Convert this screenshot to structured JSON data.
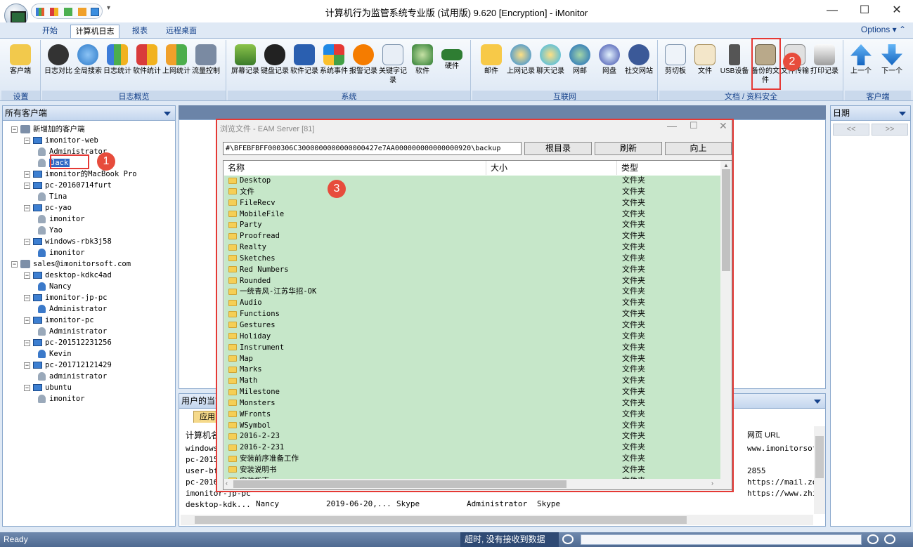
{
  "window": {
    "title": "计算机行为监管系统专业版 (试用版) 9.620 [Encryption] - iMonitor",
    "minimize": "—",
    "maximize": "☐",
    "close": "✕"
  },
  "tabs": [
    {
      "label": "开始"
    },
    {
      "label": "计算机日志",
      "active": true
    },
    {
      "label": "报表"
    },
    {
      "label": "远程桌面"
    }
  ],
  "options_label": "Options",
  "ribbon_groups": [
    {
      "label": "设置",
      "buttons": [
        {
          "label": "客户端"
        }
      ]
    },
    {
      "label": "日志概览",
      "buttons": [
        {
          "label": "日志对比"
        },
        {
          "label": "全局搜索"
        },
        {
          "label": "日志统计"
        },
        {
          "label": "软件统计"
        },
        {
          "label": "上网统计"
        },
        {
          "label": "流量控制"
        }
      ]
    },
    {
      "label": "系统",
      "buttons": [
        {
          "label": "屏幕记录"
        },
        {
          "label": "键盘记录"
        },
        {
          "label": "软件记录"
        },
        {
          "label": "系统事件"
        },
        {
          "label": "报警记录"
        },
        {
          "label": "关键字记录"
        },
        {
          "label": "软件"
        },
        {
          "label": "硬件"
        }
      ]
    },
    {
      "label": "互联网",
      "buttons": [
        {
          "label": "邮件"
        },
        {
          "label": "上网记录"
        },
        {
          "label": "聊天记录"
        },
        {
          "label": "网邮"
        },
        {
          "label": "网盘"
        },
        {
          "label": "社交网站"
        }
      ]
    },
    {
      "label": "文档 / 资料安全",
      "buttons": [
        {
          "label": "剪切板"
        },
        {
          "label": "文件"
        },
        {
          "label": "USB设备"
        },
        {
          "label": "备份的文件"
        },
        {
          "label": "文件传输"
        },
        {
          "label": "打印记录"
        }
      ]
    },
    {
      "label": "客户端",
      "buttons": [
        {
          "label": "上一个"
        },
        {
          "label": "下一个"
        }
      ]
    }
  ],
  "left_panel": {
    "title": "所有客户端"
  },
  "tree": [
    {
      "label": "新增加的客户端",
      "level": 0,
      "kind": "group"
    },
    {
      "label": "imonitor-web",
      "level": 1,
      "kind": "pc"
    },
    {
      "label": "Administrator",
      "level": 2,
      "kind": "user"
    },
    {
      "label": "Jack",
      "level": 2,
      "kind": "user",
      "selected": true
    },
    {
      "label": "imonitor的MacBook Pro",
      "level": 1,
      "kind": "pc"
    },
    {
      "label": "pc-20160714furt",
      "level": 1,
      "kind": "pc"
    },
    {
      "label": "Tina",
      "level": 2,
      "kind": "user"
    },
    {
      "label": "pc-yao",
      "level": 1,
      "kind": "pc"
    },
    {
      "label": "imonitor",
      "level": 2,
      "kind": "user"
    },
    {
      "label": "Yao",
      "level": 2,
      "kind": "user"
    },
    {
      "label": "windows-rbk3j58",
      "level": 1,
      "kind": "pc"
    },
    {
      "label": "imonitor",
      "level": 2,
      "kind": "user-blue"
    },
    {
      "label": "sales@imonitorsoft.com",
      "level": 0,
      "kind": "group"
    },
    {
      "label": "desktop-kdkc4ad",
      "level": 1,
      "kind": "pc"
    },
    {
      "label": "Nancy",
      "level": 2,
      "kind": "user-blue"
    },
    {
      "label": "imonitor-jp-pc",
      "level": 1,
      "kind": "pc"
    },
    {
      "label": "Administrator",
      "level": 2,
      "kind": "user-blue"
    },
    {
      "label": "imonitor-pc",
      "level": 1,
      "kind": "pc"
    },
    {
      "label": "Administrator",
      "level": 2,
      "kind": "user"
    },
    {
      "label": "pc-201512231256",
      "level": 1,
      "kind": "pc"
    },
    {
      "label": "Kevin",
      "level": 2,
      "kind": "user-blue"
    },
    {
      "label": "pc-201712121429",
      "level": 1,
      "kind": "pc"
    },
    {
      "label": "administrator",
      "level": 2,
      "kind": "user"
    },
    {
      "label": "ubuntu",
      "level": 1,
      "kind": "pc"
    },
    {
      "label": "imonitor",
      "level": 2,
      "kind": "user"
    }
  ],
  "right_panel": {
    "title": "日期",
    "prev": "<<",
    "next": ">>"
  },
  "bottom_panel": {
    "title": "用户的当前",
    "tab": "应用",
    "header_left": "计算机名",
    "header_right": "网页 URL",
    "rows_left": [
      "windows",
      "pc-2015",
      "user-bf",
      "pc-2016",
      "imonitor-jp-pc",
      "desktop-kdk..."
    ],
    "row_user": "Nancy",
    "row_date": "2019-06-20,...",
    "row_app": "Skype",
    "row_admin": "Administrator",
    "row_app2": "Skype",
    "urls": [
      "www.imonitorsof",
      "",
      "2855",
      "https://mail.zo",
      "https://www.zhi"
    ]
  },
  "dialog": {
    "title": "浏览文件 - EAM Server [81]",
    "path": "#\\BFEBFBFF000306C3000000000000000427e7AA000000000000000920\\backup",
    "btn_root": "根目录",
    "btn_refresh": "刷新",
    "btn_up": "向上",
    "col_name": "名称",
    "col_size": "大小",
    "col_type": "类型",
    "rows": [
      {
        "name": "Desktop",
        "type": "文件夹"
      },
      {
        "name": "文件",
        "type": "文件夹"
      },
      {
        "name": "FileRecv",
        "type": "文件夹"
      },
      {
        "name": "MobileFile",
        "type": "文件夹"
      },
      {
        "name": "Party",
        "type": "文件夹"
      },
      {
        "name": "Proofread",
        "type": "文件夹"
      },
      {
        "name": "Realty",
        "type": "文件夹"
      },
      {
        "name": "Sketches",
        "type": "文件夹"
      },
      {
        "name": "Red Numbers",
        "type": "文件夹"
      },
      {
        "name": "Rounded",
        "type": "文件夹"
      },
      {
        "name": "一统青风-江苏华招-OK",
        "type": "文件夹"
      },
      {
        "name": "Audio",
        "type": "文件夹"
      },
      {
        "name": "Functions",
        "type": "文件夹"
      },
      {
        "name": "Gestures",
        "type": "文件夹"
      },
      {
        "name": "Holiday",
        "type": "文件夹"
      },
      {
        "name": "Instrument",
        "type": "文件夹"
      },
      {
        "name": "Map",
        "type": "文件夹"
      },
      {
        "name": "Marks",
        "type": "文件夹"
      },
      {
        "name": "Math",
        "type": "文件夹"
      },
      {
        "name": "Milestone",
        "type": "文件夹"
      },
      {
        "name": "Monsters",
        "type": "文件夹"
      },
      {
        "name": "WFronts",
        "type": "文件夹"
      },
      {
        "name": "WSymbol",
        "type": "文件夹"
      },
      {
        "name": "2016-2-23",
        "type": "文件夹"
      },
      {
        "name": "2016-2-231",
        "type": "文件夹"
      },
      {
        "name": "安装前序准备工作",
        "type": "文件夹"
      },
      {
        "name": "安装说明书",
        "type": "文件夹"
      },
      {
        "name": "安装指南",
        "type": "文件夹"
      }
    ]
  },
  "badges": [
    "1",
    "2",
    "3"
  ],
  "status": {
    "left": "Ready",
    "message": "超时, 没有接收到数据"
  },
  "colors": {
    "accent": "#15428b",
    "highlight": "#e53935",
    "row_bg": "#c6e7c9"
  }
}
